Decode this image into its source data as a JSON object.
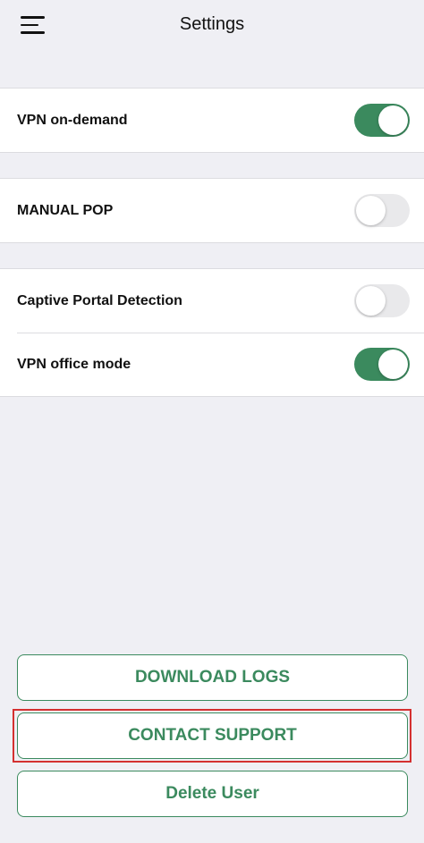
{
  "header": {
    "title": "Settings",
    "menu_icon": "hamburger-menu-icon"
  },
  "settings": {
    "vpn_on_demand": {
      "label": "VPN on-demand",
      "enabled": true
    },
    "manual_pop": {
      "label": "MANUAL POP",
      "enabled": false
    },
    "captive_portal_detection": {
      "label": "Captive Portal Detection",
      "enabled": false
    },
    "vpn_office_mode": {
      "label": "VPN office mode",
      "enabled": true
    }
  },
  "actions": {
    "download_logs": "DOWNLOAD LOGS",
    "contact_support": "CONTACT SUPPORT",
    "delete_user": "Delete User"
  },
  "colors": {
    "accent": "#3b8a5e",
    "background": "#efeff4",
    "toggle_off": "#e9e9eb",
    "highlight": "#d43030"
  }
}
